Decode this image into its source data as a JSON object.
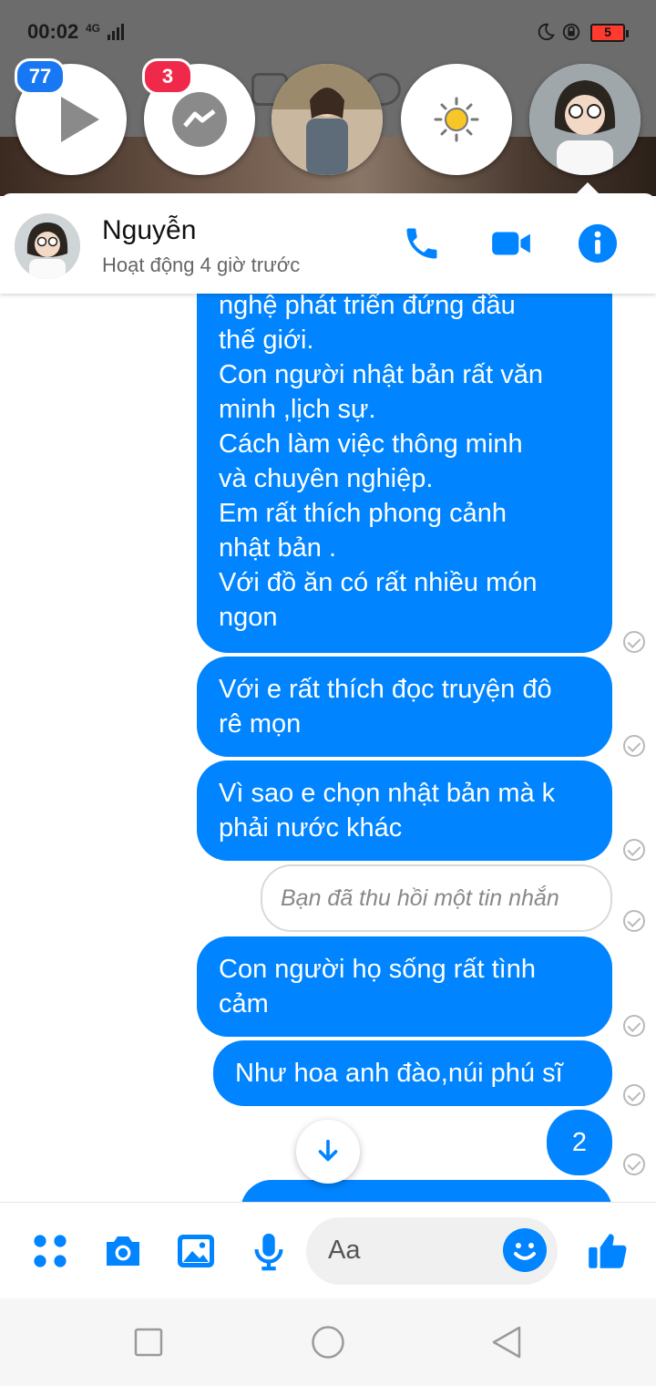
{
  "status_bar": {
    "time": "00:02",
    "network": "4G",
    "battery": "5"
  },
  "chat_heads": [
    {
      "kind": "video-player",
      "badge": "77",
      "badge_color": "#1877f2"
    },
    {
      "kind": "messenger",
      "badge": "3",
      "badge_color": "#f02849"
    },
    {
      "kind": "contact-photo"
    },
    {
      "kind": "brightness"
    },
    {
      "kind": "contact-photo-active"
    }
  ],
  "header": {
    "name": "Nguyễn",
    "status": "Hoạt động 4 giờ trước"
  },
  "messages": [
    {
      "lines": [
        "nghệ phát triển đứng đầu",
        "thế giới.",
        "Con người nhật bản rất văn",
        "minh ,lịch sự.",
        "Cách làm việc thông minh",
        "và chuyên nghiệp.",
        "Em rất thích phong cảnh",
        "nhật bản .",
        "Với đồ ăn có rất nhiều món",
        "ngon"
      ]
    },
    {
      "lines": [
        "Với e rất thích đọc truyện đô",
        "rê mọn"
      ]
    },
    {
      "lines": [
        "Vì sao e chọn nhật bản mà k",
        "phải nước khác"
      ]
    },
    {
      "recalled": "Bạn đã thu hồi một tin nhắn"
    },
    {
      "lines": [
        "Con người họ sống rất tình",
        "cảm"
      ]
    },
    {
      "lines": [
        "Như hoa anh đào,núi phú sĩ"
      ]
    },
    {
      "lines": [
        "2"
      ]
    }
  ],
  "composer": {
    "placeholder": "Aa"
  },
  "colors": {
    "accent": "#0084ff",
    "bubble_text": "#ffffff"
  }
}
